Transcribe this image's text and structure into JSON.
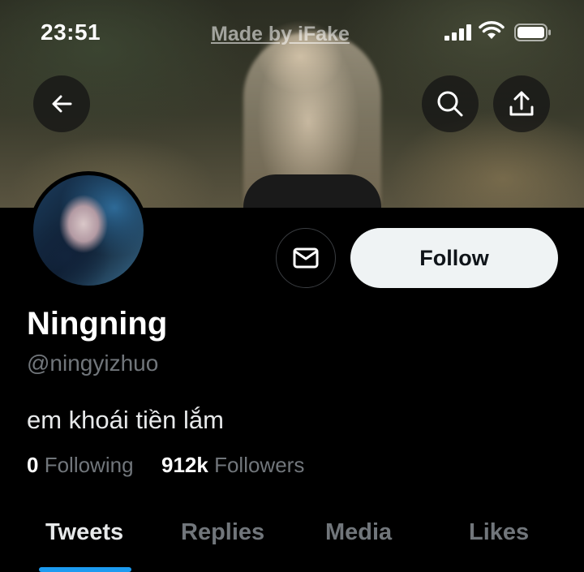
{
  "status_bar": {
    "time": "23:51",
    "watermark": "Made by iFake"
  },
  "header": {
    "back_icon": "arrow-left-icon",
    "search_icon": "search-icon",
    "share_icon": "share-icon"
  },
  "profile": {
    "display_name": "Ningning",
    "handle": "@ningyizhuo",
    "bio": "em khoái tiền lắm",
    "following_count": "0",
    "following_label": "Following",
    "followers_count": "912k",
    "followers_label": "Followers",
    "follow_button": "Follow",
    "message_icon": "envelope-icon"
  },
  "tabs": [
    {
      "label": "Tweets",
      "active": true
    },
    {
      "label": "Replies",
      "active": false
    },
    {
      "label": "Media",
      "active": false
    },
    {
      "label": "Likes",
      "active": false
    }
  ],
  "colors": {
    "accent": "#1d9bf0",
    "background": "#000000",
    "secondary_text": "#71767b",
    "follow_button_bg": "#eff3f4"
  }
}
